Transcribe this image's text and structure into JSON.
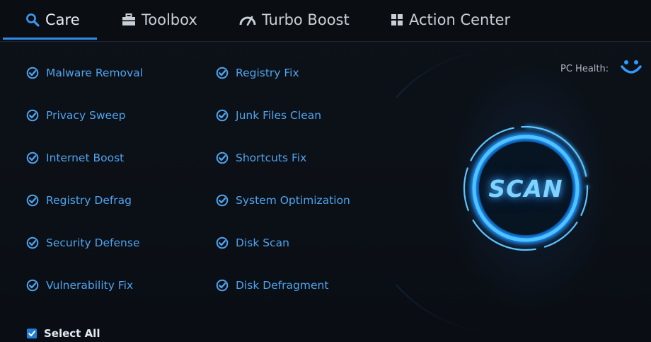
{
  "tabs": [
    {
      "label": "Care",
      "icon": "magnifier-icon",
      "active": true
    },
    {
      "label": "Toolbox",
      "icon": "toolbox-icon",
      "active": false
    },
    {
      "label": "Turbo Boost",
      "icon": "speedometer-icon",
      "active": false
    },
    {
      "label": "Action Center",
      "icon": "grid-icon",
      "active": false
    }
  ],
  "care_items_left": [
    {
      "label": "Malware Removal",
      "checked": true
    },
    {
      "label": "Privacy Sweep",
      "checked": true
    },
    {
      "label": "Internet Boost",
      "checked": true
    },
    {
      "label": "Registry Defrag",
      "checked": true
    },
    {
      "label": "Security Defense",
      "checked": true
    },
    {
      "label": "Vulnerability Fix",
      "checked": true
    }
  ],
  "care_items_right": [
    {
      "label": "Registry Fix",
      "checked": true
    },
    {
      "label": "Junk Files Clean",
      "checked": true
    },
    {
      "label": "Shortcuts Fix",
      "checked": true
    },
    {
      "label": "System Optimization",
      "checked": true
    },
    {
      "label": "Disk Scan",
      "checked": true
    },
    {
      "label": "Disk Defragment",
      "checked": true
    }
  ],
  "select_all": {
    "label": "Select All",
    "checked": true
  },
  "pc_health": {
    "label": "PC Health:",
    "icon": "smiley-icon"
  },
  "scan_button": {
    "label": "SCAN"
  },
  "colors": {
    "accent": "#2a8ee8",
    "item_text": "#4fa3ee",
    "scan_glow": "#31b4ff",
    "background": "#0b0f16"
  }
}
